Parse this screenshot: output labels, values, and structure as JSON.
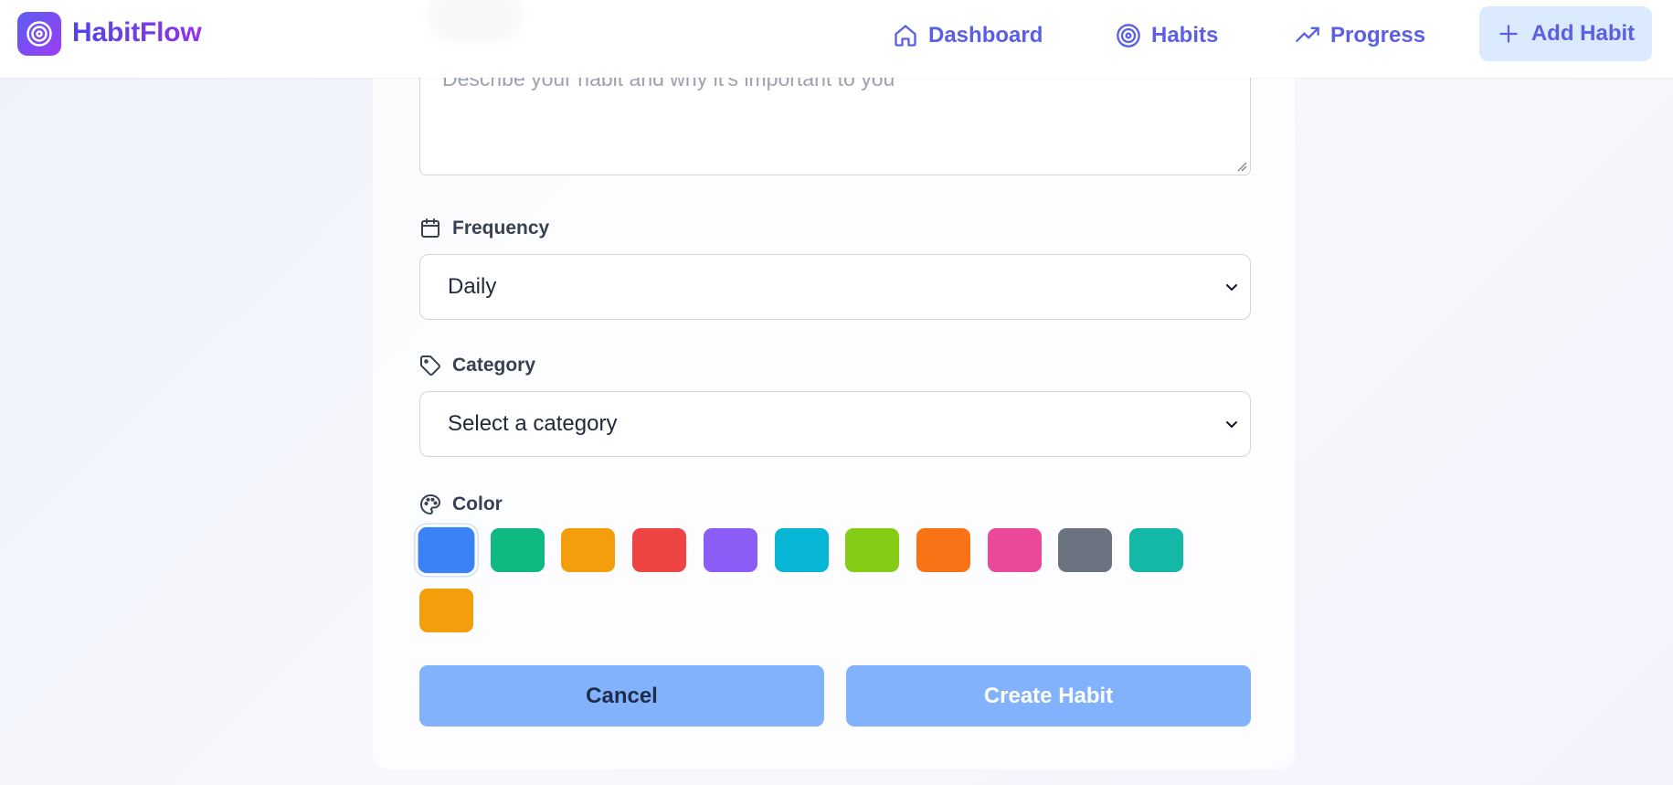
{
  "header": {
    "app_name": "HabitFlow",
    "logo_icon": "target-icon",
    "nav": [
      {
        "label": "Dashboard",
        "icon": "home-icon"
      },
      {
        "label": "Habits",
        "icon": "target-icon"
      },
      {
        "label": "Progress",
        "icon": "trending-up-icon"
      }
    ],
    "add_habit_label": "Add Habit",
    "add_habit_icon": "plus-icon"
  },
  "form": {
    "description": {
      "placeholder": "Describe your habit and why it's important to you",
      "value": ""
    },
    "frequency": {
      "label": "Frequency",
      "icon": "calendar-icon",
      "selected": "Daily"
    },
    "category": {
      "label": "Category",
      "icon": "tag-icon",
      "selected": "Select a category"
    },
    "color": {
      "label": "Color",
      "icon": "palette-icon",
      "selected_index": 0,
      "options": [
        "#3b82f6",
        "#10b981",
        "#f59e0b",
        "#ef4444",
        "#8b5cf6",
        "#06b6d4",
        "#84cc16",
        "#f97316",
        "#ec4899",
        "#6b7280",
        "#14b8a6",
        "#f59e0b"
      ]
    },
    "cancel_label": "Cancel",
    "submit_label": "Create Habit"
  },
  "theme": {
    "accent": "#5b5fe6",
    "button_bg": "#82b2fb",
    "add_habit_bg": "#dbeafe"
  }
}
